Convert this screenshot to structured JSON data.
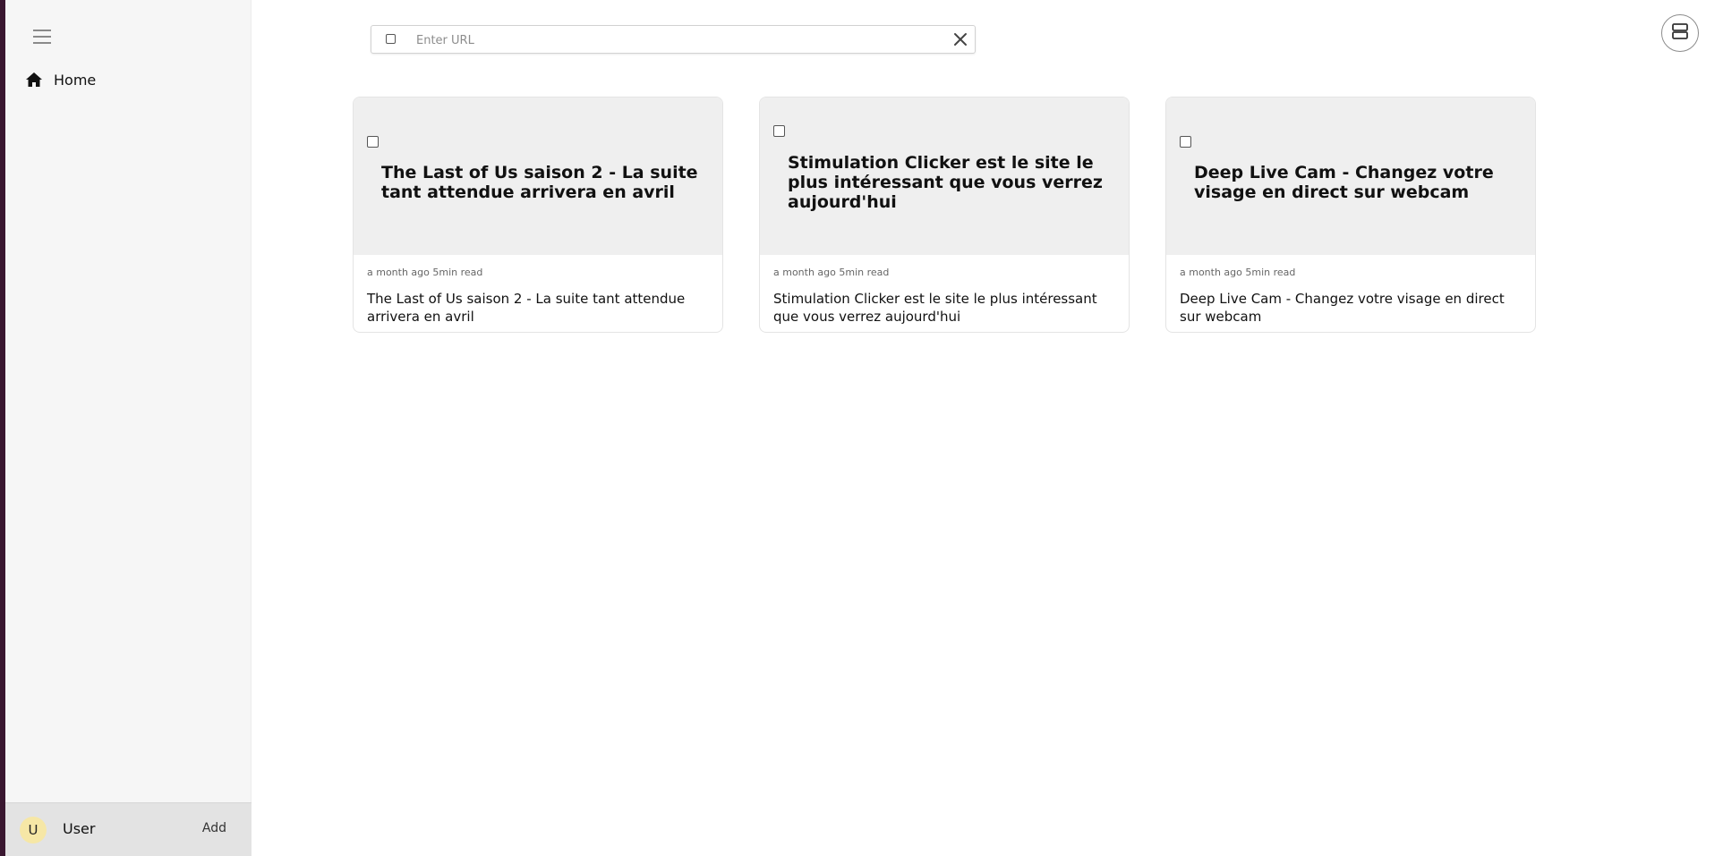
{
  "sidebar": {
    "nav": {
      "home_label": "Home"
    },
    "user": {
      "avatar_initial": "U",
      "name": "User",
      "add_label": "Add"
    }
  },
  "toolbar": {
    "url_placeholder": "Enter URL",
    "url_value": ""
  },
  "cards": [
    {
      "hero_title": "The Last of Us saison 2 - La suite tant attendue arrivera en avril",
      "meta": "a month ago 5min read",
      "title": "The Last of Us saison 2 - La suite tant attendue arrivera en avril"
    },
    {
      "hero_title": "Stimulation Clicker est le site le plus intéressant que vous verrez aujourd'hui",
      "meta": "a month ago 5min read",
      "title": "Stimulation Clicker est le site le plus intéressant que vous verrez aujourd'hui"
    },
    {
      "hero_title": "Deep Live Cam - Changez votre visage en direct sur webcam",
      "meta": "a month ago 5min read",
      "title": "Deep Live Cam - Changez votre visage en direct sur webcam"
    }
  ],
  "colors": {
    "sidebar_bg": "#f6f6f6",
    "user_bar_bg": "#e3e3e3",
    "avatar_bg": "#f6e7a6",
    "card_hero_bg": "#efefef",
    "edge_strip": "#3a1730"
  },
  "icons": {
    "menu": "hamburger-menu-icon",
    "home": "home-icon",
    "clear": "close-icon",
    "layout": "layout-rows-icon",
    "select": "checkbox-icon"
  }
}
